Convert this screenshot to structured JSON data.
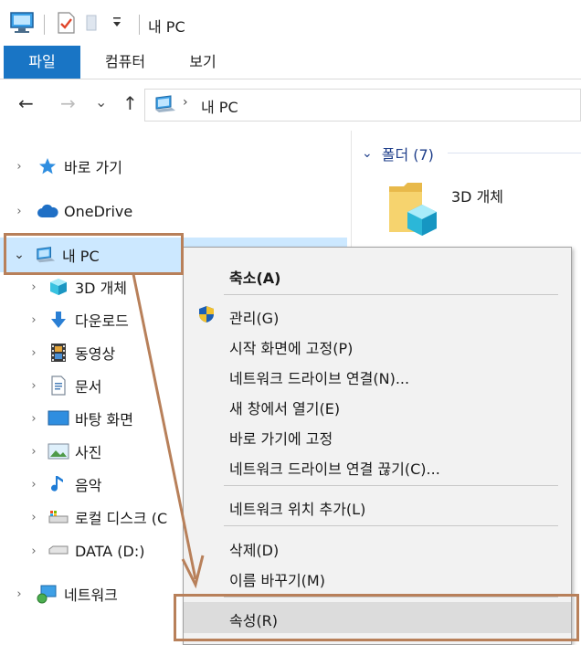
{
  "window": {
    "title": "내 PC",
    "quick_access_icons": [
      "computer-icon",
      "properties-check-icon",
      "new-folder-icon",
      "dropdown-arrow-icon"
    ]
  },
  "ribbon": {
    "tabs": [
      {
        "label": "파일",
        "active": true
      },
      {
        "label": "컴퓨터",
        "active": false
      },
      {
        "label": "보기",
        "active": false
      }
    ]
  },
  "navigation": {
    "back": "←",
    "forward": "→",
    "recent": "⌄",
    "up": "↑",
    "address": {
      "chevron": "›",
      "path": "내 PC"
    }
  },
  "nav_pane": {
    "items": [
      {
        "label": "바로 가기",
        "icon": "star-icon",
        "expanded": false
      },
      {
        "label": "OneDrive",
        "icon": "cloud-icon",
        "expanded": false
      },
      {
        "label": "내 PC",
        "icon": "computer-icon",
        "expanded": true,
        "selected": true
      },
      {
        "label": "3D 개체",
        "icon": "cube-icon"
      },
      {
        "label": "다운로드",
        "icon": "download-arrow-icon"
      },
      {
        "label": "동영상",
        "icon": "film-icon"
      },
      {
        "label": "문서",
        "icon": "document-icon"
      },
      {
        "label": "바탕 화면",
        "icon": "desktop-icon"
      },
      {
        "label": "사진",
        "icon": "picture-icon"
      },
      {
        "label": "음악",
        "icon": "music-note-icon"
      },
      {
        "label": "로컬 디스크 (C",
        "icon": "drive-icon"
      },
      {
        "label": "DATA (D:)",
        "icon": "drive-icon"
      },
      {
        "label": "네트워크",
        "icon": "network-icon",
        "expanded": false
      }
    ]
  },
  "content": {
    "group_header": "폴더 (7)",
    "folders": [
      {
        "label": "3D 개체",
        "icon": "folder-3d-icon"
      }
    ]
  },
  "context_menu": {
    "items": [
      {
        "label": "축소(A)",
        "bold": true
      },
      {
        "label": "관리(G)",
        "icon": "shield-icon"
      },
      {
        "label": "시작 화면에 고정(P)"
      },
      {
        "label": "네트워크 드라이브 연결(N)..."
      },
      {
        "label": "새 창에서 열기(E)"
      },
      {
        "label": "바로 가기에 고정"
      },
      {
        "label": "네트워크 드라이브 연결 끊기(C)..."
      },
      {
        "label": "네트워크 위치 추가(L)"
      },
      {
        "label": "삭제(D)"
      },
      {
        "label": "이름 바꾸기(M)"
      },
      {
        "label": "속성(R)",
        "highlighted": true
      }
    ]
  },
  "colors": {
    "accent": "#1975c5",
    "selection": "#cce8ff",
    "annotation": "#b8805a",
    "menu_bg": "#f2f2f2",
    "menu_highlight": "#dcdcdc"
  }
}
